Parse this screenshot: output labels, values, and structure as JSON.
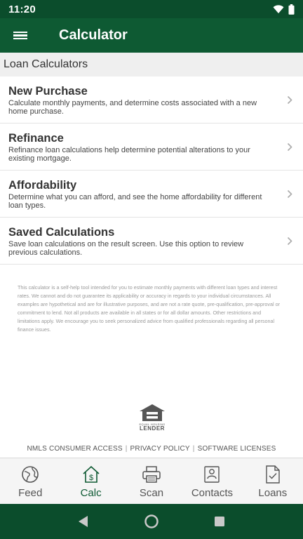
{
  "status_bar": {
    "time": "11:20"
  },
  "app_bar": {
    "title": "Calculator"
  },
  "section": {
    "title": "Loan Calculators"
  },
  "items": [
    {
      "title": "New Purchase",
      "description": "Calculate monthly payments, and determine costs associated with a new home purchase."
    },
    {
      "title": "Refinance",
      "description": "Refinance loan calculations help determine potential alterations to your existing mortgage."
    },
    {
      "title": "Affordability",
      "description": "Determine what you can afford, and see the home affordability for different loan types."
    },
    {
      "title": "Saved Calculations",
      "description": "Save loan calculations on the result screen. Use this option to review previous calculations."
    }
  ],
  "disclaimer": "This calculator is a self-help tool intended for you to estimate monthly payments with different loan types and interest rates. We cannot and do not guarantee its applicability or accuracy in regards to your individual circumstances. All examples are hypothetical and are for illustrative purposes, and are not a rate quote, pre-qualification, pre-approval or commitment to lend. Not all products are available in all states or for all dollar amounts. Other restrictions and limitations apply. We encourage you to seek personalized advice from qualified professionals regarding all personal finance issues.",
  "logo": {
    "small_text": "EQUAL HOUSING",
    "big_text": "LENDER"
  },
  "footer": {
    "nmls": "NMLS CONSUMER ACCESS",
    "privacy": "PRIVACY POLICY",
    "licenses": "SOFTWARE LICENSES",
    "separator": "|"
  },
  "nav": {
    "feed": "Feed",
    "calc": "Calc",
    "scan": "Scan",
    "contacts": "Contacts",
    "loans": "Loans"
  },
  "colors": {
    "primary": "#0e5a33",
    "status_bar": "#0b4d2c",
    "active_tab": "#0e5a33"
  }
}
